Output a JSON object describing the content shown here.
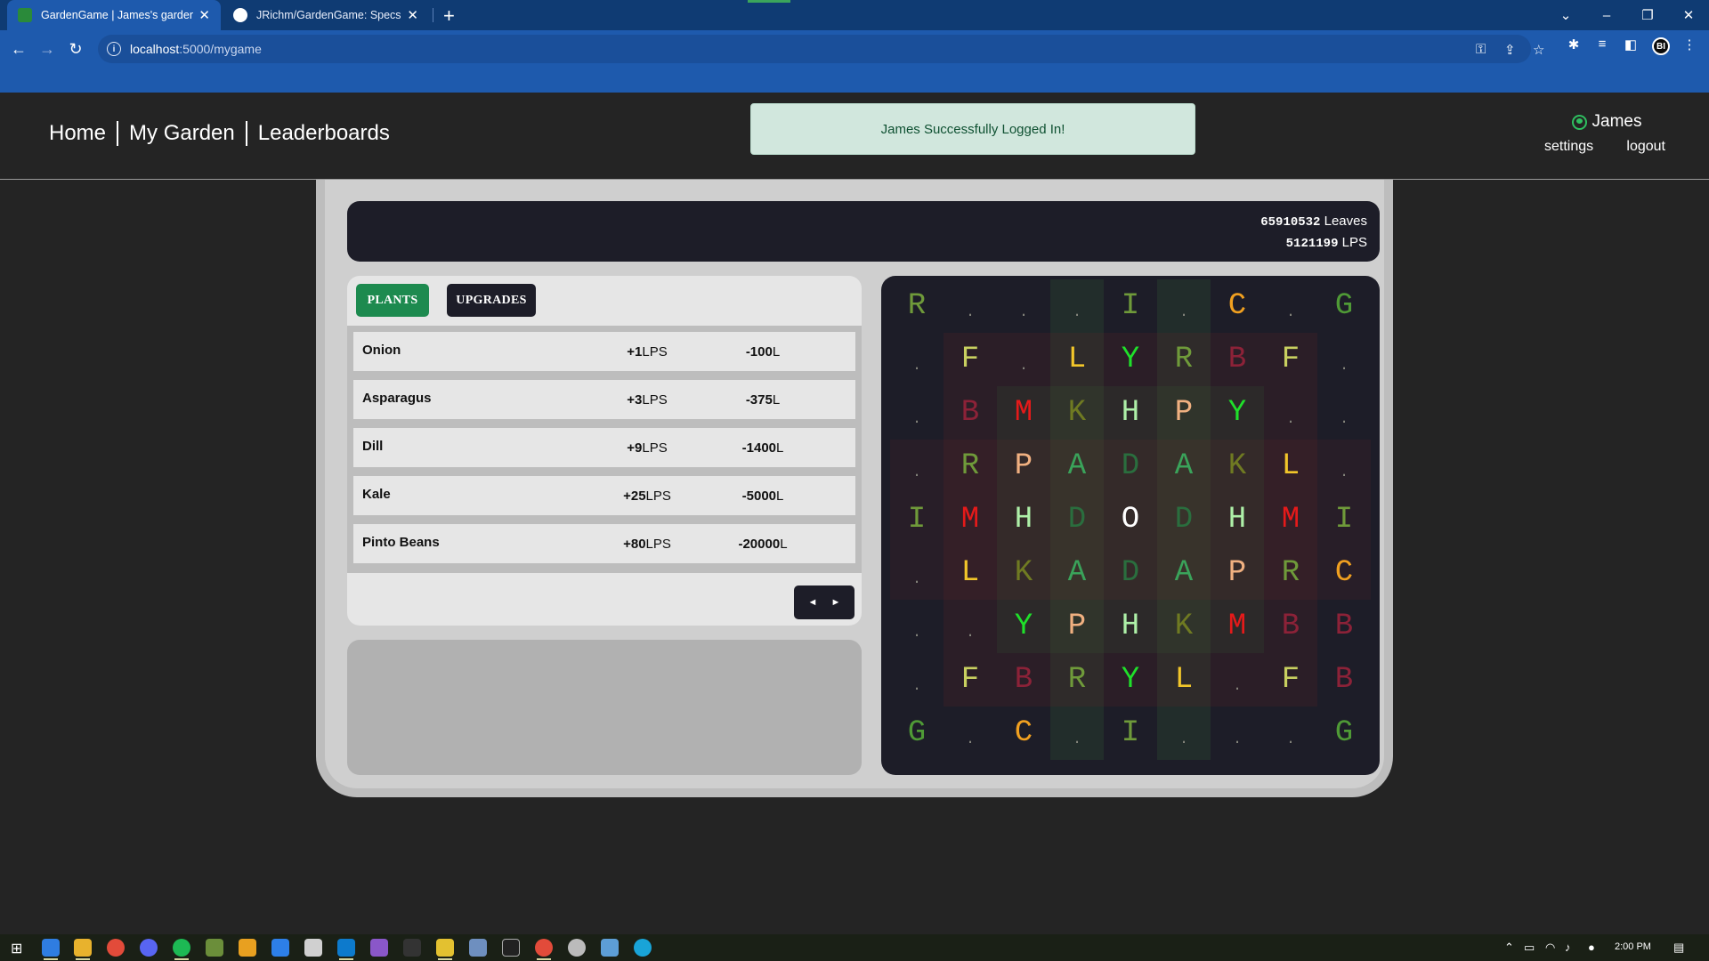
{
  "browser": {
    "tabs": [
      {
        "title": "GardenGame | James's garden",
        "active": true
      },
      {
        "title": "JRichm/GardenGame: Specs Cap",
        "active": false
      }
    ],
    "url_host": "localhost",
    "url_path": ":5000/mygame",
    "profile_initials": "BI"
  },
  "nav": {
    "home": "Home",
    "my_garden": "My Garden",
    "leaderboards": "Leaderboards"
  },
  "flash_message": "James Successfully Logged In!",
  "user": {
    "name": "James",
    "settings": "settings",
    "logout": "logout"
  },
  "stats": {
    "leaves": "65910532",
    "leaves_label": "Leaves",
    "lps": "5121199",
    "lps_label": "LPS"
  },
  "shop": {
    "tabs": {
      "plants": "PLANTS",
      "upgrades": "UPGRADES"
    },
    "items": [
      {
        "name": "Onion",
        "rate": "+1",
        "rate_unit": "LPS",
        "cost": "-100",
        "cost_unit": "L"
      },
      {
        "name": "Asparagus",
        "rate": "+3",
        "rate_unit": "LPS",
        "cost": "-375",
        "cost_unit": "L"
      },
      {
        "name": "Dill",
        "rate": "+9",
        "rate_unit": "LPS",
        "cost": "-1400",
        "cost_unit": "L"
      },
      {
        "name": "Kale",
        "rate": "+25",
        "rate_unit": "LPS",
        "cost": "-5000",
        "cost_unit": "L"
      },
      {
        "name": "Pinto Beans",
        "rate": "+80",
        "rate_unit": "LPS",
        "cost": "-20000",
        "cost_unit": "L"
      }
    ],
    "pager": {
      "prev": "◄",
      "next": "►"
    }
  },
  "garden": {
    "rows": [
      [
        "R",
        ".",
        ".",
        ".",
        "I",
        ".",
        "C",
        ".",
        "G"
      ],
      [
        ".",
        "F",
        ".",
        "L",
        "Y",
        "R",
        "B",
        "F",
        "."
      ],
      [
        ".",
        "B",
        "M",
        "K",
        "H",
        "P",
        "Y",
        ".",
        "."
      ],
      [
        ".",
        "R",
        "P",
        "A",
        "D",
        "A",
        "K",
        "L",
        "."
      ],
      [
        "I",
        "M",
        "H",
        "D",
        "O",
        "D",
        "H",
        "M",
        "I"
      ],
      [
        ".",
        "L",
        "K",
        "A",
        "D",
        "A",
        "P",
        "R",
        "C"
      ],
      [
        ".",
        ".",
        "Y",
        "P",
        "H",
        "K",
        "M",
        "B",
        "B"
      ],
      [
        ".",
        "F",
        "B",
        "R",
        "Y",
        "L",
        ".",
        "F",
        "B"
      ],
      [
        "G",
        ".",
        "C",
        ".",
        "I",
        ".",
        ".",
        ".",
        "G"
      ]
    ],
    "colors": {
      "R": "#6f9a3a",
      "I": "#6f9a3a",
      "C": "#f0a020",
      "G": "#4f9a36",
      "F": "#c8d060",
      "L": "#f2c62a",
      "Y": "#1fe02a",
      "B": "#8c2238",
      "M": "#e51a1a",
      "K": "#6f7a22",
      "H": "#aef0a8",
      "P": "#f0b080",
      "A": "#3aa35a",
      "D": "#2a6e3e",
      "O": "#ffffff",
      ".": "#8a8a80"
    }
  },
  "taskbar": {
    "clock": "2:00 PM"
  }
}
